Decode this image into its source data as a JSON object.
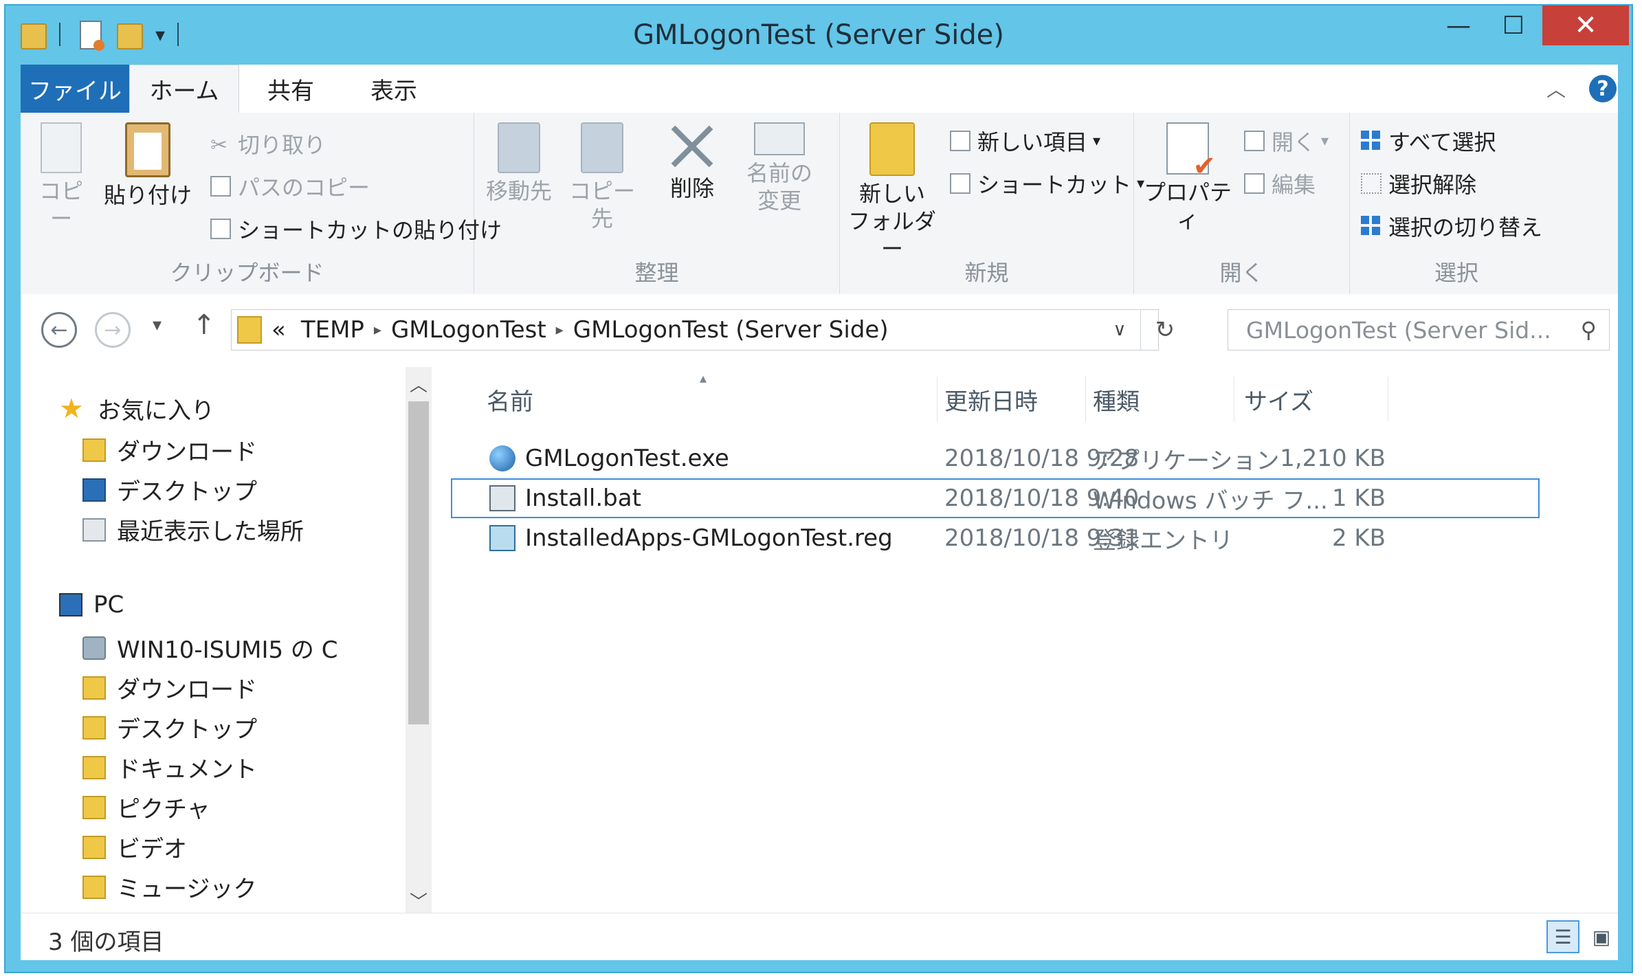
{
  "window": {
    "title": "GMLogonTest (Server Side)",
    "controls": {
      "minimize": "—",
      "maximize": "☐",
      "close": "✕"
    }
  },
  "ribbon_tabs": [
    "ファイル",
    "ホーム",
    "共有",
    "表示"
  ],
  "ribbon": {
    "clipboard": {
      "label": "クリップボード",
      "copy": "コピー",
      "paste": "貼り付け",
      "cut": "切り取り",
      "copy_path": "パスのコピー",
      "paste_shortcut": "ショートカットの貼り付け"
    },
    "organize": {
      "label": "整理",
      "move_to": "移動先",
      "copy_to": "コピー先",
      "delete": "削除",
      "rename_1": "名前の",
      "rename_2": "変更"
    },
    "new": {
      "label": "新規",
      "new_folder_1": "新しい",
      "new_folder_2": "フォルダー",
      "new_item": "新しい項目",
      "shortcut": "ショートカット"
    },
    "open": {
      "label": "開く",
      "properties": "プロパティ",
      "open": "開く",
      "edit": "編集"
    },
    "select": {
      "label": "選択",
      "select_all": "すべて選択",
      "select_none": "選択解除",
      "invert": "選択の切り替え"
    }
  },
  "address": {
    "prefix": "«",
    "crumbs": [
      "TEMP",
      "GMLogonTest",
      "GMLogonTest (Server Side)"
    ],
    "search_placeholder": "GMLogonTest (Server Sid..."
  },
  "nav_pane": {
    "favorites": {
      "label": "お気に入り",
      "items": [
        "ダウンロード",
        "デスクトップ",
        "最近表示した場所"
      ]
    },
    "pc": {
      "label": "PC",
      "items": [
        "WIN10-ISUMI5 の C",
        "ダウンロード",
        "デスクトップ",
        "ドキュメント",
        "ピクチャ",
        "ビデオ",
        "ミュージック"
      ]
    }
  },
  "columns": [
    "名前",
    "更新日時",
    "種類",
    "サイズ"
  ],
  "files": [
    {
      "name": "GMLogonTest.exe",
      "modified": "2018/10/18 9:28",
      "type": "アプリケーション",
      "size": "1,210 KB"
    },
    {
      "name": "Install.bat",
      "modified": "2018/10/18 9:40",
      "type": "Windows バッチ フ...",
      "size": "1 KB"
    },
    {
      "name": "InstalledApps-GMLogonTest.reg",
      "modified": "2018/10/18 9:31",
      "type": "登録エントリ",
      "size": "2 KB"
    }
  ],
  "status": {
    "count": "3 個の項目"
  },
  "colors": {
    "title_bar": "#63c5e8",
    "file_tab": "#1e6fb8",
    "close_button": "#c7403a",
    "selection_border": "#3c8fdb"
  }
}
